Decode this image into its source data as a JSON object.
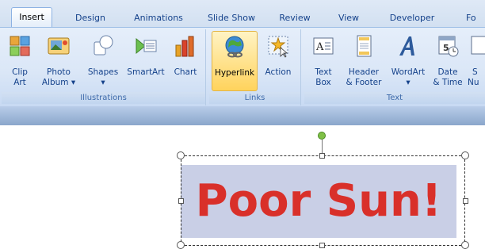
{
  "tabs": [
    {
      "label": "Insert",
      "active": true
    },
    {
      "label": "Design"
    },
    {
      "label": "Animations"
    },
    {
      "label": "Slide Show"
    },
    {
      "label": "Review"
    },
    {
      "label": "View"
    },
    {
      "label": "Developer"
    },
    {
      "label": "Fo"
    }
  ],
  "groups": {
    "illustrations": {
      "label": "Illustrations",
      "buttons": [
        {
          "line1": "Clip",
          "line2": "Art",
          "icon": "clip-art-icon"
        },
        {
          "line1": "Photo",
          "line2": "Album ▾",
          "icon": "photo-album-icon"
        },
        {
          "line1": "Shapes",
          "line2": "▾",
          "icon": "shapes-icon"
        },
        {
          "line1": "SmartArt",
          "line2": "",
          "icon": "smartart-icon"
        },
        {
          "line1": "Chart",
          "line2": "",
          "icon": "chart-icon"
        }
      ]
    },
    "links": {
      "label": "Links",
      "buttons": [
        {
          "line1": "Hyperlink",
          "line2": "",
          "icon": "hyperlink-icon",
          "active": true
        },
        {
          "line1": "Action",
          "line2": "",
          "icon": "action-icon"
        }
      ]
    },
    "text": {
      "label": "Text",
      "buttons": [
        {
          "line1": "Text",
          "line2": "Box",
          "icon": "text-box-icon"
        },
        {
          "line1": "Header",
          "line2": "& Footer",
          "icon": "header-footer-icon"
        },
        {
          "line1": "WordArt",
          "line2": "▾",
          "icon": "wordart-icon"
        },
        {
          "line1": "Date",
          "line2": "& Time",
          "icon": "date-time-icon"
        },
        {
          "line1": "S",
          "line2": "Nu",
          "icon": "slide-number-icon"
        }
      ]
    }
  },
  "slide": {
    "text": "Poor Sun!",
    "text_color": "#d9302a",
    "fill_color": "#c9cfe6"
  },
  "colors": {
    "accent_active": "#ffd35c",
    "ribbon_text": "#15428b"
  }
}
